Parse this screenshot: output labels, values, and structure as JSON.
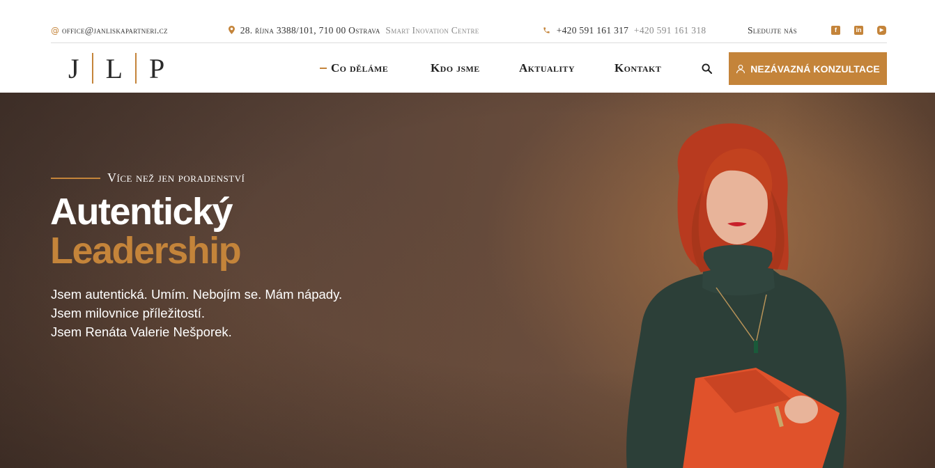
{
  "topbar": {
    "email": "office@janliskapartneri.cz",
    "address": "28. října 3388/101, 710 00 Ostrava",
    "address_note": "Smart Inovation Centre",
    "phone_primary": "+420 591 161 317",
    "phone_secondary": "+420 591 161 318",
    "follow_label": "Sledujte nás",
    "social": [
      {
        "icon": "facebook-icon",
        "glyph": "f"
      },
      {
        "icon": "linkedin-icon",
        "glyph": "in"
      },
      {
        "icon": "youtube-icon",
        "glyph": "▶"
      }
    ]
  },
  "header": {
    "logo_letters": [
      "J",
      "L",
      "P"
    ],
    "nav": [
      "Co děláme",
      "Kdo jsme",
      "Aktuality",
      "Kontakt"
    ],
    "active_nav": "Co děláme",
    "cta_label": "NEZÁVAZNÁ KONZULTACE"
  },
  "hero": {
    "eyebrow": "Více než jen poradenství",
    "title_line1": "Autentický",
    "title_line2": "Leadership",
    "lines": [
      "Jsem autentická. Umím. Nebojím se. Mám nápady.",
      "Jsem milovnice příležitostí.",
      "Jsem Renáta Valerie Nešporek."
    ]
  },
  "colors": {
    "accent": "#c4843a",
    "hero_background": "#5c4539",
    "text_dark": "#1f1f1f",
    "white": "#ffffff"
  }
}
